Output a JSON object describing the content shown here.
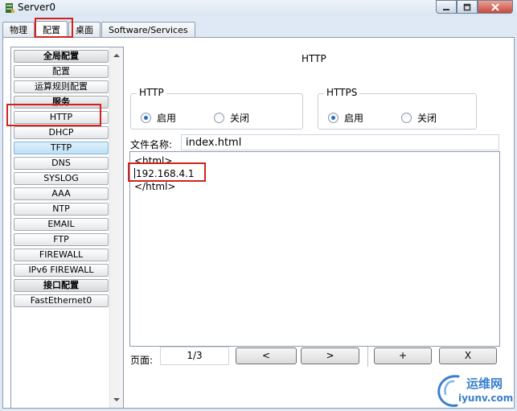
{
  "window": {
    "title": "Server0"
  },
  "tabs": [
    {
      "label": "物理"
    },
    {
      "label": "配置"
    },
    {
      "label": "桌面"
    },
    {
      "label": "Software/Services"
    }
  ],
  "sidebar": {
    "items": [
      {
        "label": "全局配置"
      },
      {
        "label": "配置"
      },
      {
        "label": "运算规则配置"
      },
      {
        "label": "服务"
      },
      {
        "label": "HTTP"
      },
      {
        "label": "DHCP"
      },
      {
        "label": "TFTP"
      },
      {
        "label": "DNS"
      },
      {
        "label": "SYSLOG"
      },
      {
        "label": "AAA"
      },
      {
        "label": "NTP"
      },
      {
        "label": "EMAIL"
      },
      {
        "label": "FTP"
      },
      {
        "label": "FIREWALL"
      },
      {
        "label": "IPv6 FIREWALL"
      },
      {
        "label": "接口配置"
      },
      {
        "label": "FastEthernet0"
      }
    ]
  },
  "panel": {
    "title": "HTTP"
  },
  "http_group": {
    "label": "HTTP",
    "on_label": "启用",
    "off_label": "关闭",
    "selected": "on"
  },
  "https_group": {
    "label": "HTTPS",
    "on_label": "启用",
    "off_label": "关闭",
    "selected": "on"
  },
  "file": {
    "label": "文件名称:",
    "value": "index.html"
  },
  "editor": {
    "lines": [
      "<html>",
      "192.168.4.1",
      "</html>"
    ]
  },
  "pager": {
    "label": "页面:",
    "value": "1/3"
  },
  "buttons": {
    "prev": "<",
    "next": ">",
    "add": "+",
    "remove": "X"
  },
  "watermark": {
    "cn": "运维网",
    "en": "iyunv.com"
  },
  "colors": {
    "highlight": "#d0231f",
    "selected_item": "#bfe0f6",
    "watermark": "#3a7fcf"
  }
}
